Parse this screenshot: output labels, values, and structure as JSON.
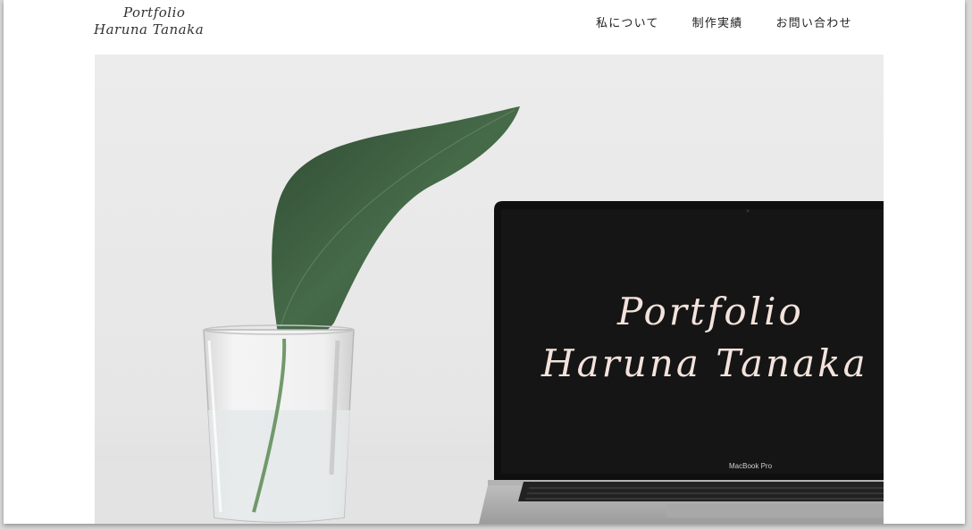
{
  "header": {
    "logo_line1": "Portfolio",
    "logo_line2": "Haruna Tanaka"
  },
  "nav": {
    "items": [
      {
        "label": "私について"
      },
      {
        "label": "制作実績"
      },
      {
        "label": "お問い合わせ"
      }
    ]
  },
  "hero": {
    "screen_title_line1": "Portfolio",
    "screen_title_line2": "Haruna Tanaka",
    "laptop_brand": "MacBook Pro"
  },
  "colors": {
    "background": "#ffffff",
    "hero_wall": "#e9e9e9",
    "screen": "#151515",
    "leaf": "#3d5a40",
    "screen_text": "#f3e3dc"
  }
}
